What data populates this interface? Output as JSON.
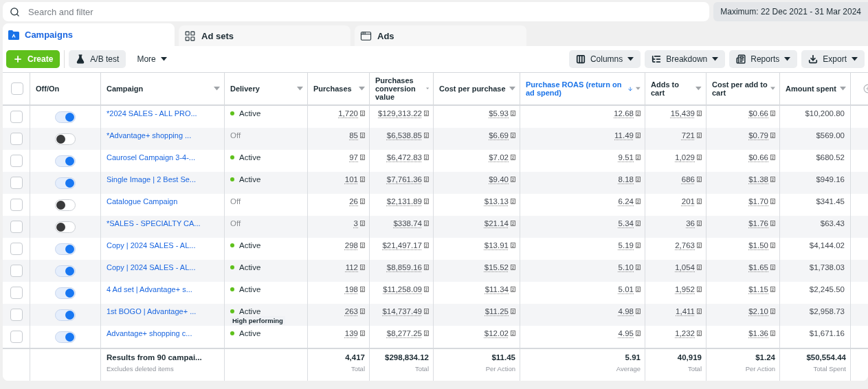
{
  "search": {
    "placeholder": "Search and filter"
  },
  "date_range": "Maximum: 22 Dec 2021 - 31 Mar 2024",
  "tabs": [
    {
      "label": "Campaigns",
      "selected": true,
      "kind": "campaigns"
    },
    {
      "label": "Ad sets",
      "selected": false,
      "kind": "adsets"
    },
    {
      "label": "Ads",
      "selected": false,
      "kind": "ads"
    }
  ],
  "toolbar_left": [
    {
      "label": "Create",
      "kind": "create"
    },
    {
      "label": "A/B test",
      "kind": "abtest"
    },
    {
      "label": "More",
      "kind": "more"
    }
  ],
  "toolbar_right": [
    {
      "label": "Columns",
      "kind": "columns"
    },
    {
      "label": "Breakdown",
      "kind": "breakdown"
    },
    {
      "label": "Reports",
      "kind": "reports"
    },
    {
      "label": "Export",
      "kind": "export"
    }
  ],
  "table": {
    "header_checked": false,
    "columns": [
      {
        "label": "Off/On",
        "kind": "toggle",
        "sorted": false
      },
      {
        "label": "Campaign",
        "kind": "name",
        "sorted": false
      },
      {
        "label": "Delivery",
        "kind": "delivery",
        "sorted": false
      },
      {
        "label": "Purchases",
        "kind": "metric",
        "sorted": false
      },
      {
        "label": "Purchases conversion value",
        "kind": "metric",
        "sorted": false
      },
      {
        "label": "Cost per purchase",
        "kind": "metric",
        "sorted": false
      },
      {
        "label": "Purchase ROAS (return on ad spend)",
        "kind": "metric",
        "sorted": true
      },
      {
        "label": "Adds to cart",
        "kind": "metric",
        "sorted": false
      },
      {
        "label": "Cost per add to cart",
        "kind": "metric",
        "sorted": false
      },
      {
        "label": "Amount spent",
        "kind": "plain",
        "sorted": false
      }
    ],
    "rows": [
      {
        "checked": false,
        "on": true,
        "campaign": "*2024 SALES - ALL PRO...",
        "delivery": "Active",
        "active": true,
        "values": [
          "1,720",
          "$129,313.22",
          "$5.93",
          "12.68",
          "15,439",
          "$0.66",
          "$10,200.80"
        ]
      },
      {
        "checked": false,
        "on": false,
        "campaign": "*Advantage+ shopping ...",
        "delivery": "Off",
        "active": false,
        "values": [
          "85",
          "$6,538.85",
          "$6.69",
          "11.49",
          "721",
          "$0.79",
          "$569.00"
        ]
      },
      {
        "checked": false,
        "on": true,
        "campaign": "Caurosel Campaign 3-4-...",
        "delivery": "Active",
        "active": true,
        "values": [
          "97",
          "$6,472.83",
          "$7.02",
          "9.51",
          "1,029",
          "$0.66",
          "$680.52"
        ]
      },
      {
        "checked": false,
        "on": true,
        "campaign": "Single Image | 2 Best Se...",
        "delivery": "Active",
        "active": true,
        "values": [
          "101",
          "$7,761.36",
          "$9.40",
          "8.18",
          "686",
          "$1.38",
          "$949.16"
        ]
      },
      {
        "checked": false,
        "on": false,
        "campaign": "Catalogue Campaign",
        "delivery": "Off",
        "active": false,
        "values": [
          "26",
          "$2,131.89",
          "$13.13",
          "6.24",
          "201",
          "$1.70",
          "$341.45"
        ]
      },
      {
        "checked": false,
        "on": false,
        "campaign": "*SALES - SPECIALTY CA...",
        "delivery": "Off",
        "active": false,
        "values": [
          "3",
          "$338.74",
          "$21.14",
          "5.34",
          "36",
          "$1.76",
          "$63.43"
        ]
      },
      {
        "checked": false,
        "on": true,
        "campaign": "Copy | 2024 SALES - AL...",
        "delivery": "Active",
        "active": true,
        "values": [
          "298",
          "$21,497.17",
          "$13.91",
          "5.19",
          "2,763",
          "$1.50",
          "$4,144.02"
        ]
      },
      {
        "checked": false,
        "on": true,
        "campaign": "Copy | 2024 SALES - AL...",
        "delivery": "Active",
        "active": true,
        "values": [
          "112",
          "$8,859.16",
          "$15.52",
          "5.10",
          "1,054",
          "$1.65",
          "$1,738.03"
        ]
      },
      {
        "checked": false,
        "on": true,
        "campaign": "4 Ad set | Advantage+ s...",
        "delivery": "Active",
        "active": true,
        "values": [
          "198",
          "$11,258.09",
          "$11.34",
          "5.01",
          "1,952",
          "$1.15",
          "$2,245.50"
        ]
      },
      {
        "checked": false,
        "on": true,
        "campaign": "1st BOGO | Advantage+ ...",
        "delivery": "Active",
        "active": true,
        "badge": "High performing",
        "values": [
          "263",
          "$14,737.49",
          "$11.25",
          "4.98",
          "1,411",
          "$2.10",
          "$2,958.73"
        ]
      },
      {
        "checked": false,
        "on": true,
        "campaign": "Advantage+ shopping c...",
        "delivery": "Active",
        "active": true,
        "values": [
          "139",
          "$8,277.25",
          "$12.02",
          "4.95",
          "1,232",
          "$1.36",
          "$1,671.16"
        ]
      }
    ],
    "footer": {
      "title": "Results from 90 campai...",
      "subtitle": "Excludes deleted items",
      "totals": [
        {
          "value": "4,417",
          "label": "Total"
        },
        {
          "value": "$298,834.12",
          "label": "Total"
        },
        {
          "value": "$11.45",
          "label": "Per Action"
        },
        {
          "value": "5.91",
          "label": "Average"
        },
        {
          "value": "40,919",
          "label": "Total"
        },
        {
          "value": "$1.24",
          "label": "Per Action"
        },
        {
          "value": "$50,554.44",
          "label": "Total Spent"
        }
      ]
    }
  }
}
